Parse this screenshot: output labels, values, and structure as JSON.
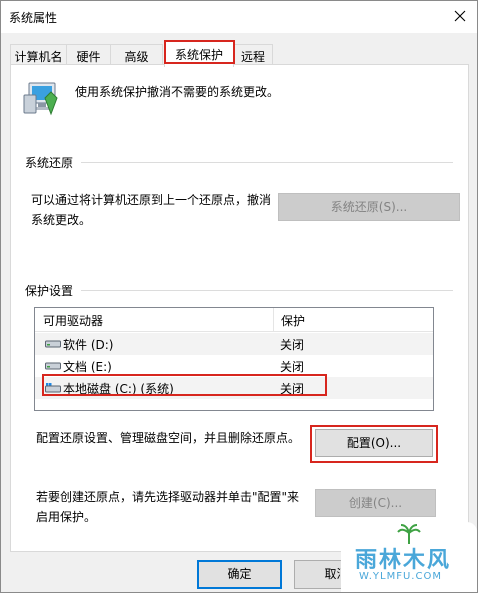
{
  "window": {
    "title": "系统属性"
  },
  "tabs": [
    {
      "label": "计算机名"
    },
    {
      "label": "硬件"
    },
    {
      "label": "高级"
    },
    {
      "label": "系统保护"
    },
    {
      "label": "远程"
    }
  ],
  "intro": {
    "text": "使用系统保护撤消不需要的系统更改。"
  },
  "restore": {
    "title": "系统还原",
    "desc_line1": "可以通过将计算机还原到上一个还原点，撤消",
    "desc_line2": "系统更改。",
    "button": "系统还原(S)..."
  },
  "protection": {
    "title": "保护设置",
    "col_drive": "可用驱动器",
    "col_state": "保护",
    "drives": [
      {
        "name": "软件 (D:)",
        "state": "关闭"
      },
      {
        "name": "文档 (E:)",
        "state": "关闭"
      },
      {
        "name": "本地磁盘 (C:) (系统)",
        "state": "关闭"
      }
    ],
    "config_desc": "配置还原设置、管理磁盘空间，并且删除还原点。",
    "config_button": "配置(O)...",
    "create_desc_line1": "若要创建还原点，请先选择驱动器并单击\"配置\"来",
    "create_desc_line2": "启用保护。",
    "create_button": "创建(C)..."
  },
  "footer": {
    "ok_button": "确定",
    "cancel_button": "取消"
  },
  "watermark": {
    "title": "雨林木风",
    "url": "W.YLMFU.COM"
  },
  "colors": {
    "highlight": "#d7261e",
    "accent": "#0078d7",
    "watermark": "#4aa7d9"
  }
}
